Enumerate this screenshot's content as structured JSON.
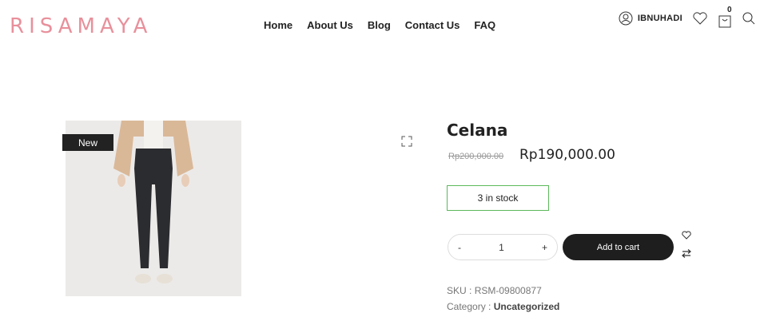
{
  "brand": {
    "logo": "RISAMAYA",
    "accent": "#e8909b"
  },
  "nav": {
    "items": [
      "Home",
      "About Us",
      "Blog",
      "Contact Us",
      "FAQ"
    ]
  },
  "account": {
    "username": "IBNUHADI",
    "cart_count": "0"
  },
  "product": {
    "badge": "New",
    "title": "Celana",
    "price_old": "Rp200,000.00",
    "price_new": "Rp190,000.00",
    "stock": "3 in stock",
    "quantity": {
      "minus": "-",
      "value": "1",
      "plus": "+"
    },
    "add_to_cart": "Add to cart",
    "sku_label": "SKU :",
    "sku_value": "RSM-09800877",
    "category_label": "Category :",
    "category_value": "Uncategorized"
  },
  "icons": [
    "user-icon",
    "heart-icon",
    "cart-icon",
    "search-icon",
    "expand-icon",
    "wishlist-icon",
    "compare-icon"
  ],
  "colors": {
    "stock_border": "#5cb85c",
    "button_bg": "#1e1e1e"
  }
}
